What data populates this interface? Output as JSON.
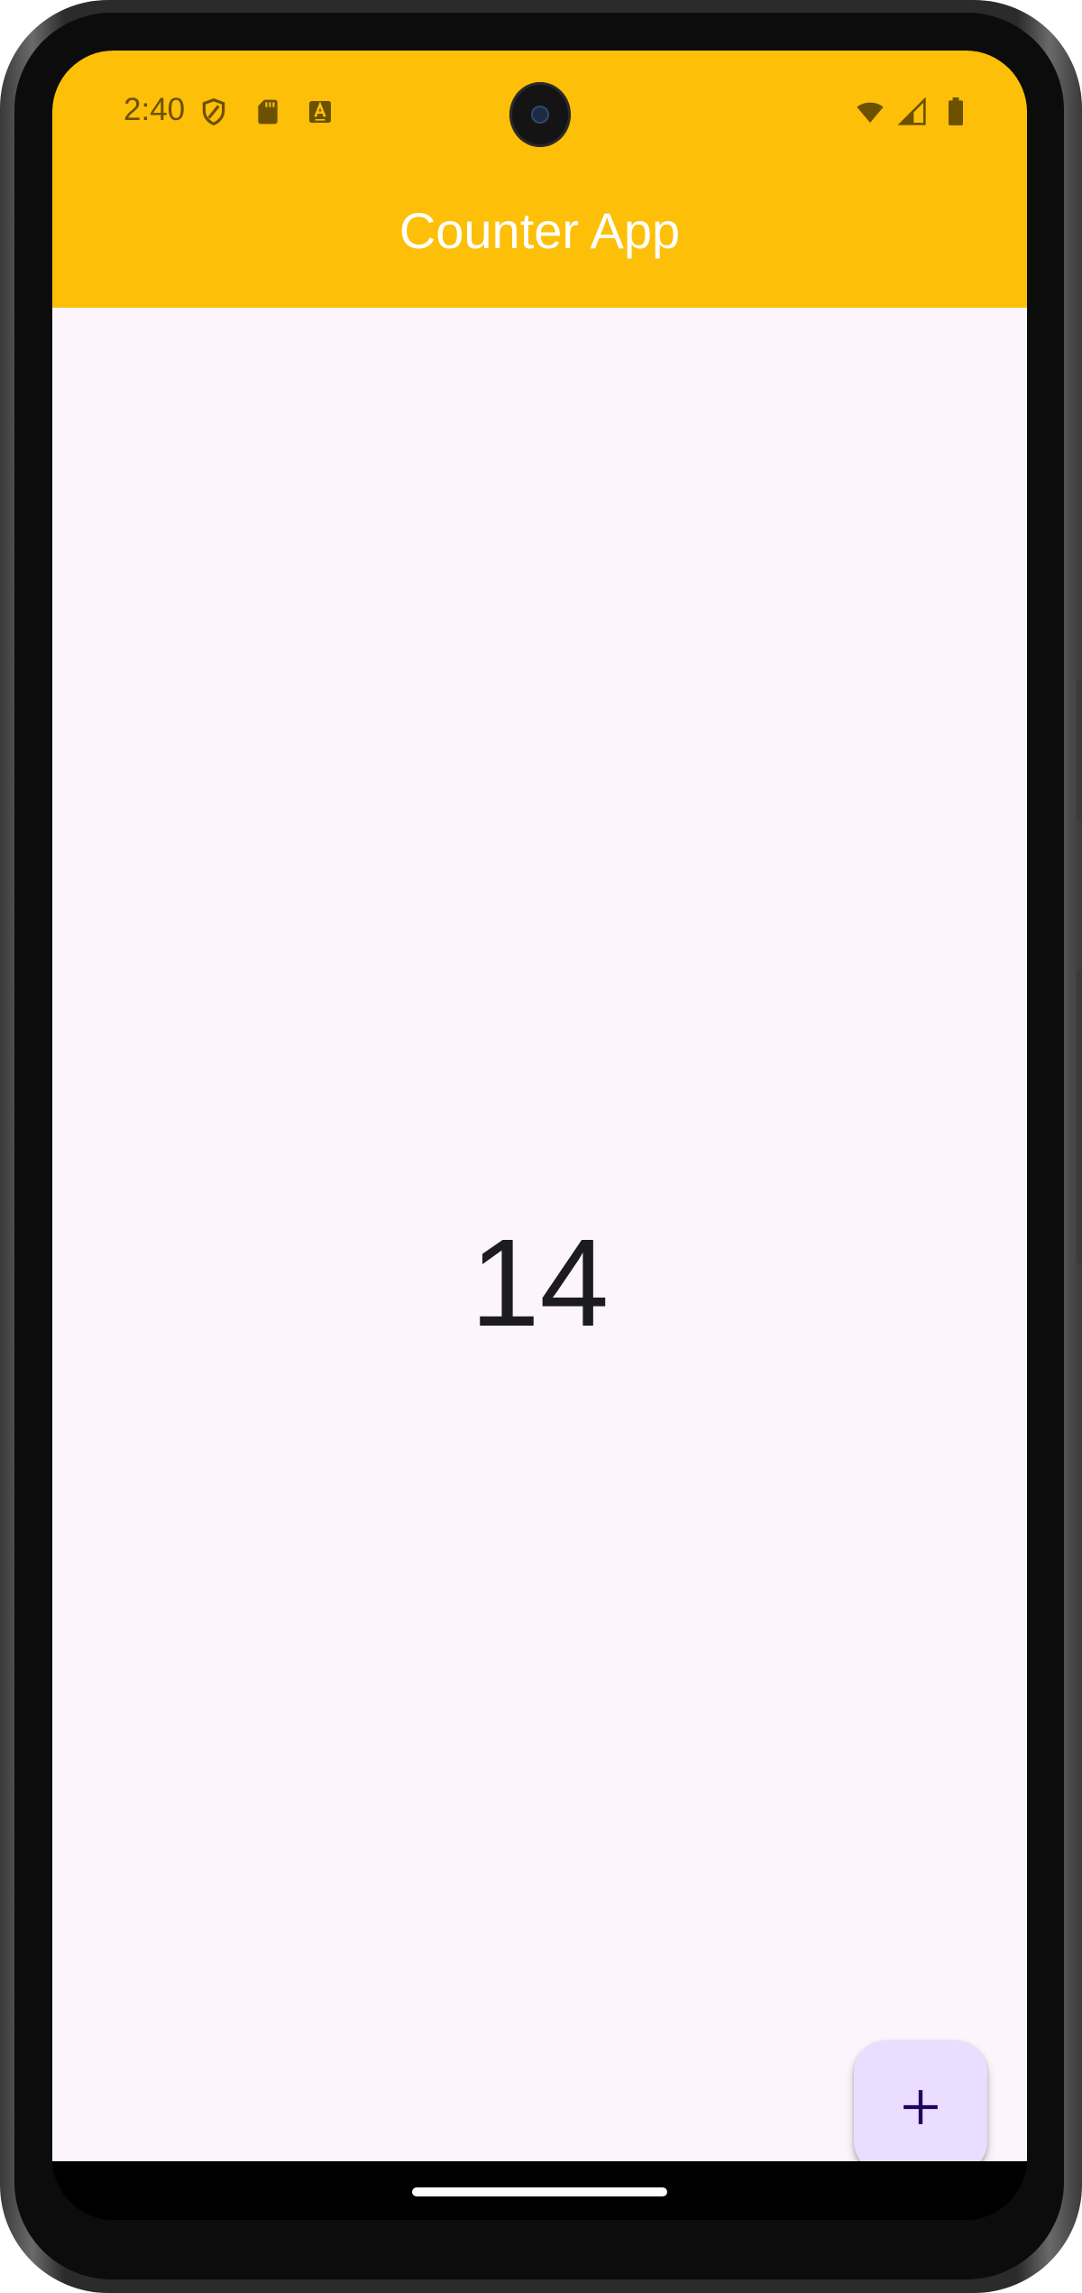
{
  "status_bar": {
    "time": "2:40",
    "icons_left": [
      "shield-icon",
      "sd-card-icon",
      "keyboard-a-icon"
    ],
    "icons_right": [
      "wifi-icon",
      "signal-icon",
      "battery-icon"
    ]
  },
  "app_bar": {
    "title": "Counter App",
    "background_color": "#FDBF07",
    "title_color": "#FFFFFF"
  },
  "main": {
    "counter_value": "14",
    "background_color": "#FCF5FC"
  },
  "fab": {
    "icon": "plus-icon",
    "background_color": "#EADDFF"
  }
}
